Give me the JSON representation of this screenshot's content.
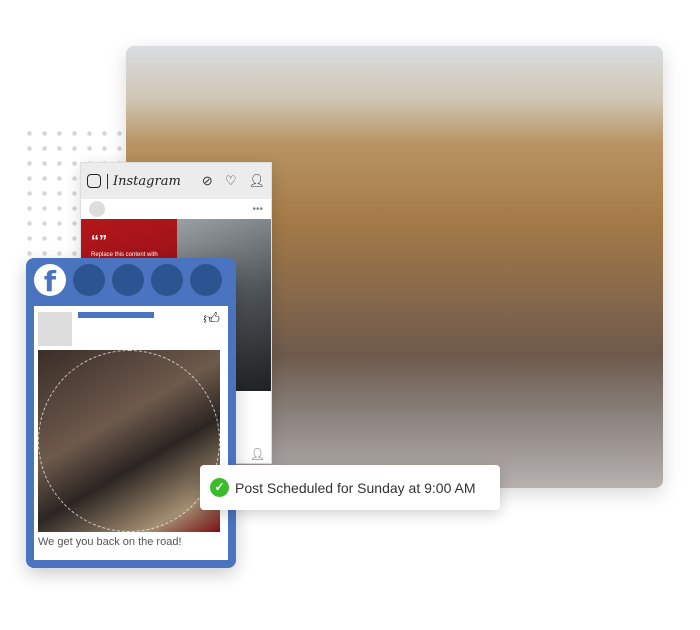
{
  "instagram": {
    "brand": "Instagram",
    "post_text": "Replace this content with your own content. Content",
    "quote_mark": "“”",
    "icons": [
      "instagram-icon",
      "compass-icon",
      "heart-icon",
      "user-icon",
      "more-icon"
    ]
  },
  "facebook": {
    "caption": "We get you back on the road!",
    "icons": [
      "facebook-icon",
      "thumbs-up-icon"
    ],
    "brand_color": "#4a74c0"
  },
  "toast": {
    "message": "Post Scheduled for Sunday at 9:00 AM",
    "status_color": "#3cbc2c"
  }
}
